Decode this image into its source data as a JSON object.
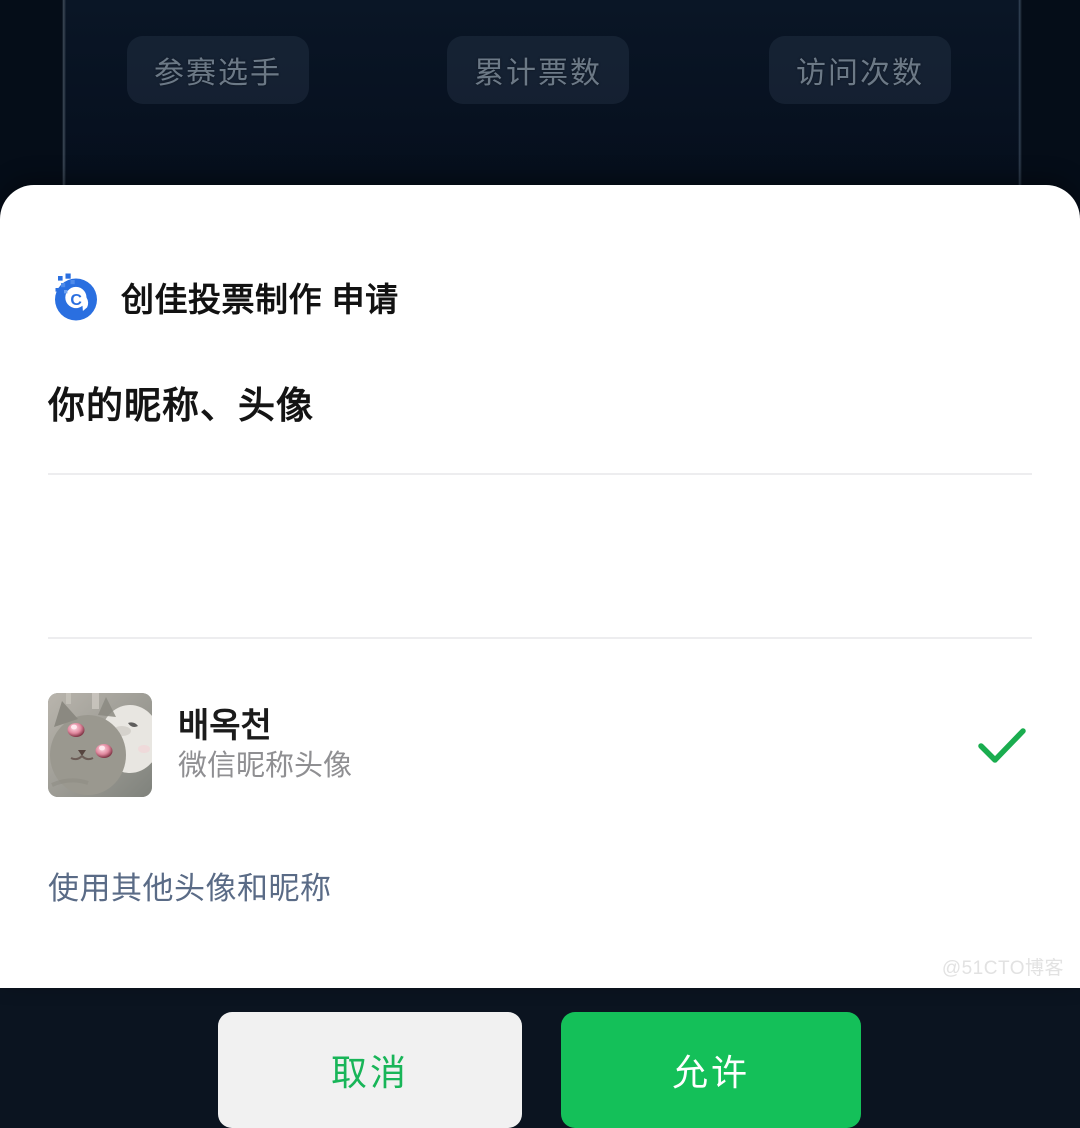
{
  "background": {
    "pills": [
      {
        "label": "参赛选手",
        "name": "contestants"
      },
      {
        "label": "累计票数",
        "name": "total-votes"
      },
      {
        "label": "访问次数",
        "name": "visit-count"
      }
    ]
  },
  "sheet": {
    "header": {
      "logo_icon": "creat-jia-logo-icon",
      "logo_letter": "C",
      "title": "创佳投票制作 申请",
      "brand_color": "#2a6fe0"
    },
    "scope_title": "你的昵称、头像",
    "profile": {
      "avatar_icon": "cat-photo-avatar",
      "name": "배옥천",
      "subtitle": "微信昵称头像",
      "selected_icon": "check-icon",
      "check_color": "#1aad4f"
    },
    "other_link": "使用其他头像和昵称",
    "buttons": {
      "cancel": "取消",
      "allow": "允许",
      "allow_bg": "#14c059",
      "cancel_fg": "#18b558"
    }
  },
  "watermark": "@51CTO博客"
}
